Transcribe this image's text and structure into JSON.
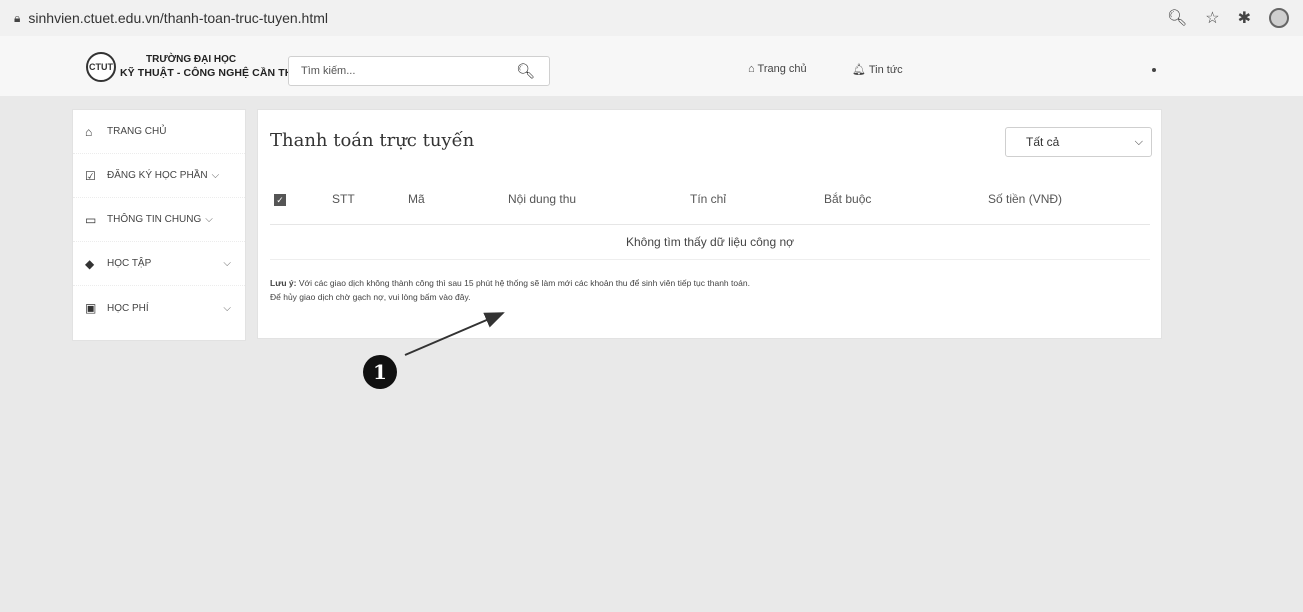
{
  "browser": {
    "url": "sinhvien.ctuet.edu.vn/thanh-toan-truc-tuyen.html"
  },
  "header": {
    "logo_text": "CTUT",
    "logo_line1": "TRƯỜNG ĐẠI HỌC",
    "logo_line2": "KỸ THUẬT - CÔNG NGHỆ CẦN THƠ",
    "search_placeholder": "Tìm kiếm...",
    "nav_home": "Trang chủ",
    "nav_news": "Tin tức"
  },
  "sidebar": {
    "items": [
      {
        "label": "TRANG CHỦ",
        "icon": "home-icon",
        "has_chevron": false
      },
      {
        "label": "ĐĂNG KÝ HỌC PHẦN",
        "icon": "checkbox-icon",
        "has_chevron": true
      },
      {
        "label": "THÔNG TIN CHUNG",
        "icon": "monitor-icon",
        "has_chevron": true
      },
      {
        "label": "HỌC TẬP",
        "icon": "graduation-cap-icon",
        "has_chevron": true
      },
      {
        "label": "HỌC PHÍ",
        "icon": "money-icon",
        "has_chevron": true
      }
    ]
  },
  "main": {
    "title": "Thanh toán trực tuyến",
    "filter_value": "Tất cả",
    "table": {
      "columns": [
        "STT",
        "Mã",
        "Nội dung thu",
        "Tín chỉ",
        "Bắt buộc",
        "Số tiền (VNĐ)"
      ],
      "empty_message": "Không tìm thấy dữ liệu công nợ"
    },
    "note_label": "Lưu ý:",
    "note_line1": "Với các giao dịch không thành công thì sau 15 phút hệ thống sẽ làm mới các khoản thu để sinh viên tiếp tục thanh toán.",
    "note_line2": "Để hủy giao dịch chờ gạch nợ, vui lòng bấm vào đây."
  },
  "annotation": {
    "marker": "1"
  }
}
